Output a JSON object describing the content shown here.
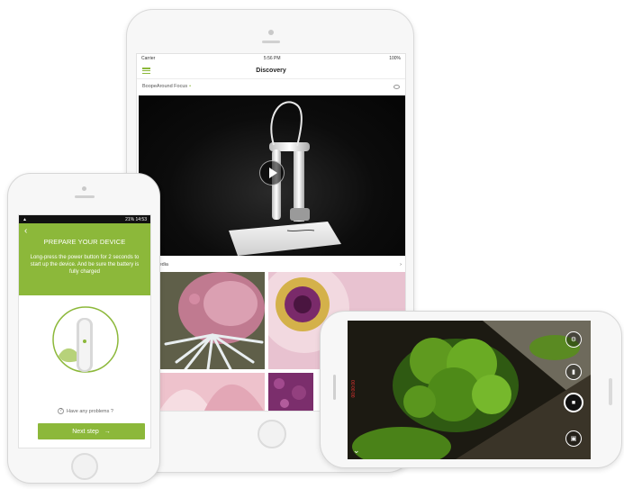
{
  "tablet": {
    "status": {
      "carrier": "Carrier",
      "time": "5:56 PM",
      "battery": "100%"
    },
    "nav_title": "Discovery",
    "section_title": "BoopeAround Focus",
    "media_label": "Media",
    "grid_images": [
      "pink-spiky-flower",
      "purple-daisy-macro",
      "pink-petals-closeup",
      "purple-texture"
    ]
  },
  "phone": {
    "status": {
      "left": "▲",
      "right": "21% 14:53"
    },
    "heading": "PREPARE YOUR DEVICE",
    "instructions": "Long-press the power button for 2 seconds to start up the device. And be sure the battery is fully charged",
    "help_text": "Have any problems ?",
    "next_label": "Next step",
    "next_arrow": "→"
  },
  "landscape": {
    "recording_time": "00:00:00",
    "controls": [
      "settings-icon",
      "switch-icon",
      "record-icon",
      "gallery-icon"
    ]
  },
  "colors": {
    "accent": "#8cb83a",
    "dark": "#111111"
  }
}
